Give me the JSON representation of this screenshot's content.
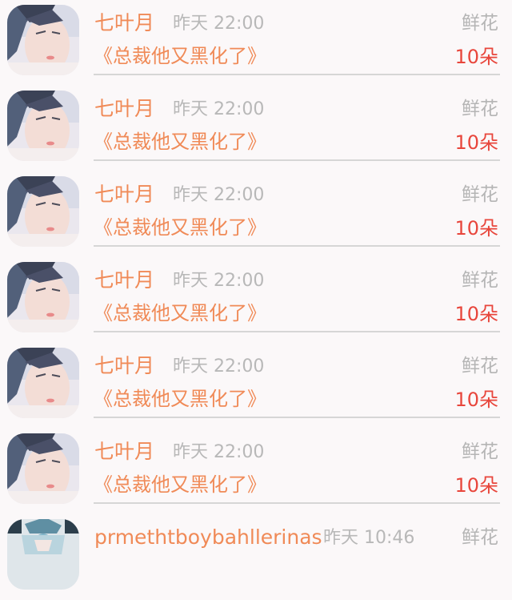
{
  "rows": [
    {
      "name": "七叶月",
      "time": "昨天 22:00",
      "gift": "鲜花",
      "book": "《总裁他又黑化了》",
      "count": "10朵"
    },
    {
      "name": "七叶月",
      "time": "昨天 22:00",
      "gift": "鲜花",
      "book": "《总裁他又黑化了》",
      "count": "10朵"
    },
    {
      "name": "七叶月",
      "time": "昨天 22:00",
      "gift": "鲜花",
      "book": "《总裁他又黑化了》",
      "count": "10朵"
    },
    {
      "name": "七叶月",
      "time": "昨天 22:00",
      "gift": "鲜花",
      "book": "《总裁他又黑化了》",
      "count": "10朵"
    },
    {
      "name": "七叶月",
      "time": "昨天 22:00",
      "gift": "鲜花",
      "book": "《总裁他又黑化了》",
      "count": "10朵"
    },
    {
      "name": "七叶月",
      "time": "昨天 22:00",
      "gift": "鲜花",
      "book": "《总裁他又黑化了》",
      "count": "10朵"
    },
    {
      "name": "prmethtboybahllerinas",
      "time": "昨天 10:46",
      "gift": "鲜花"
    }
  ],
  "colors": {
    "accent": "#f08a57",
    "count": "#e8463c",
    "muted": "#b8b8b8",
    "background": "#fbf8f9"
  }
}
